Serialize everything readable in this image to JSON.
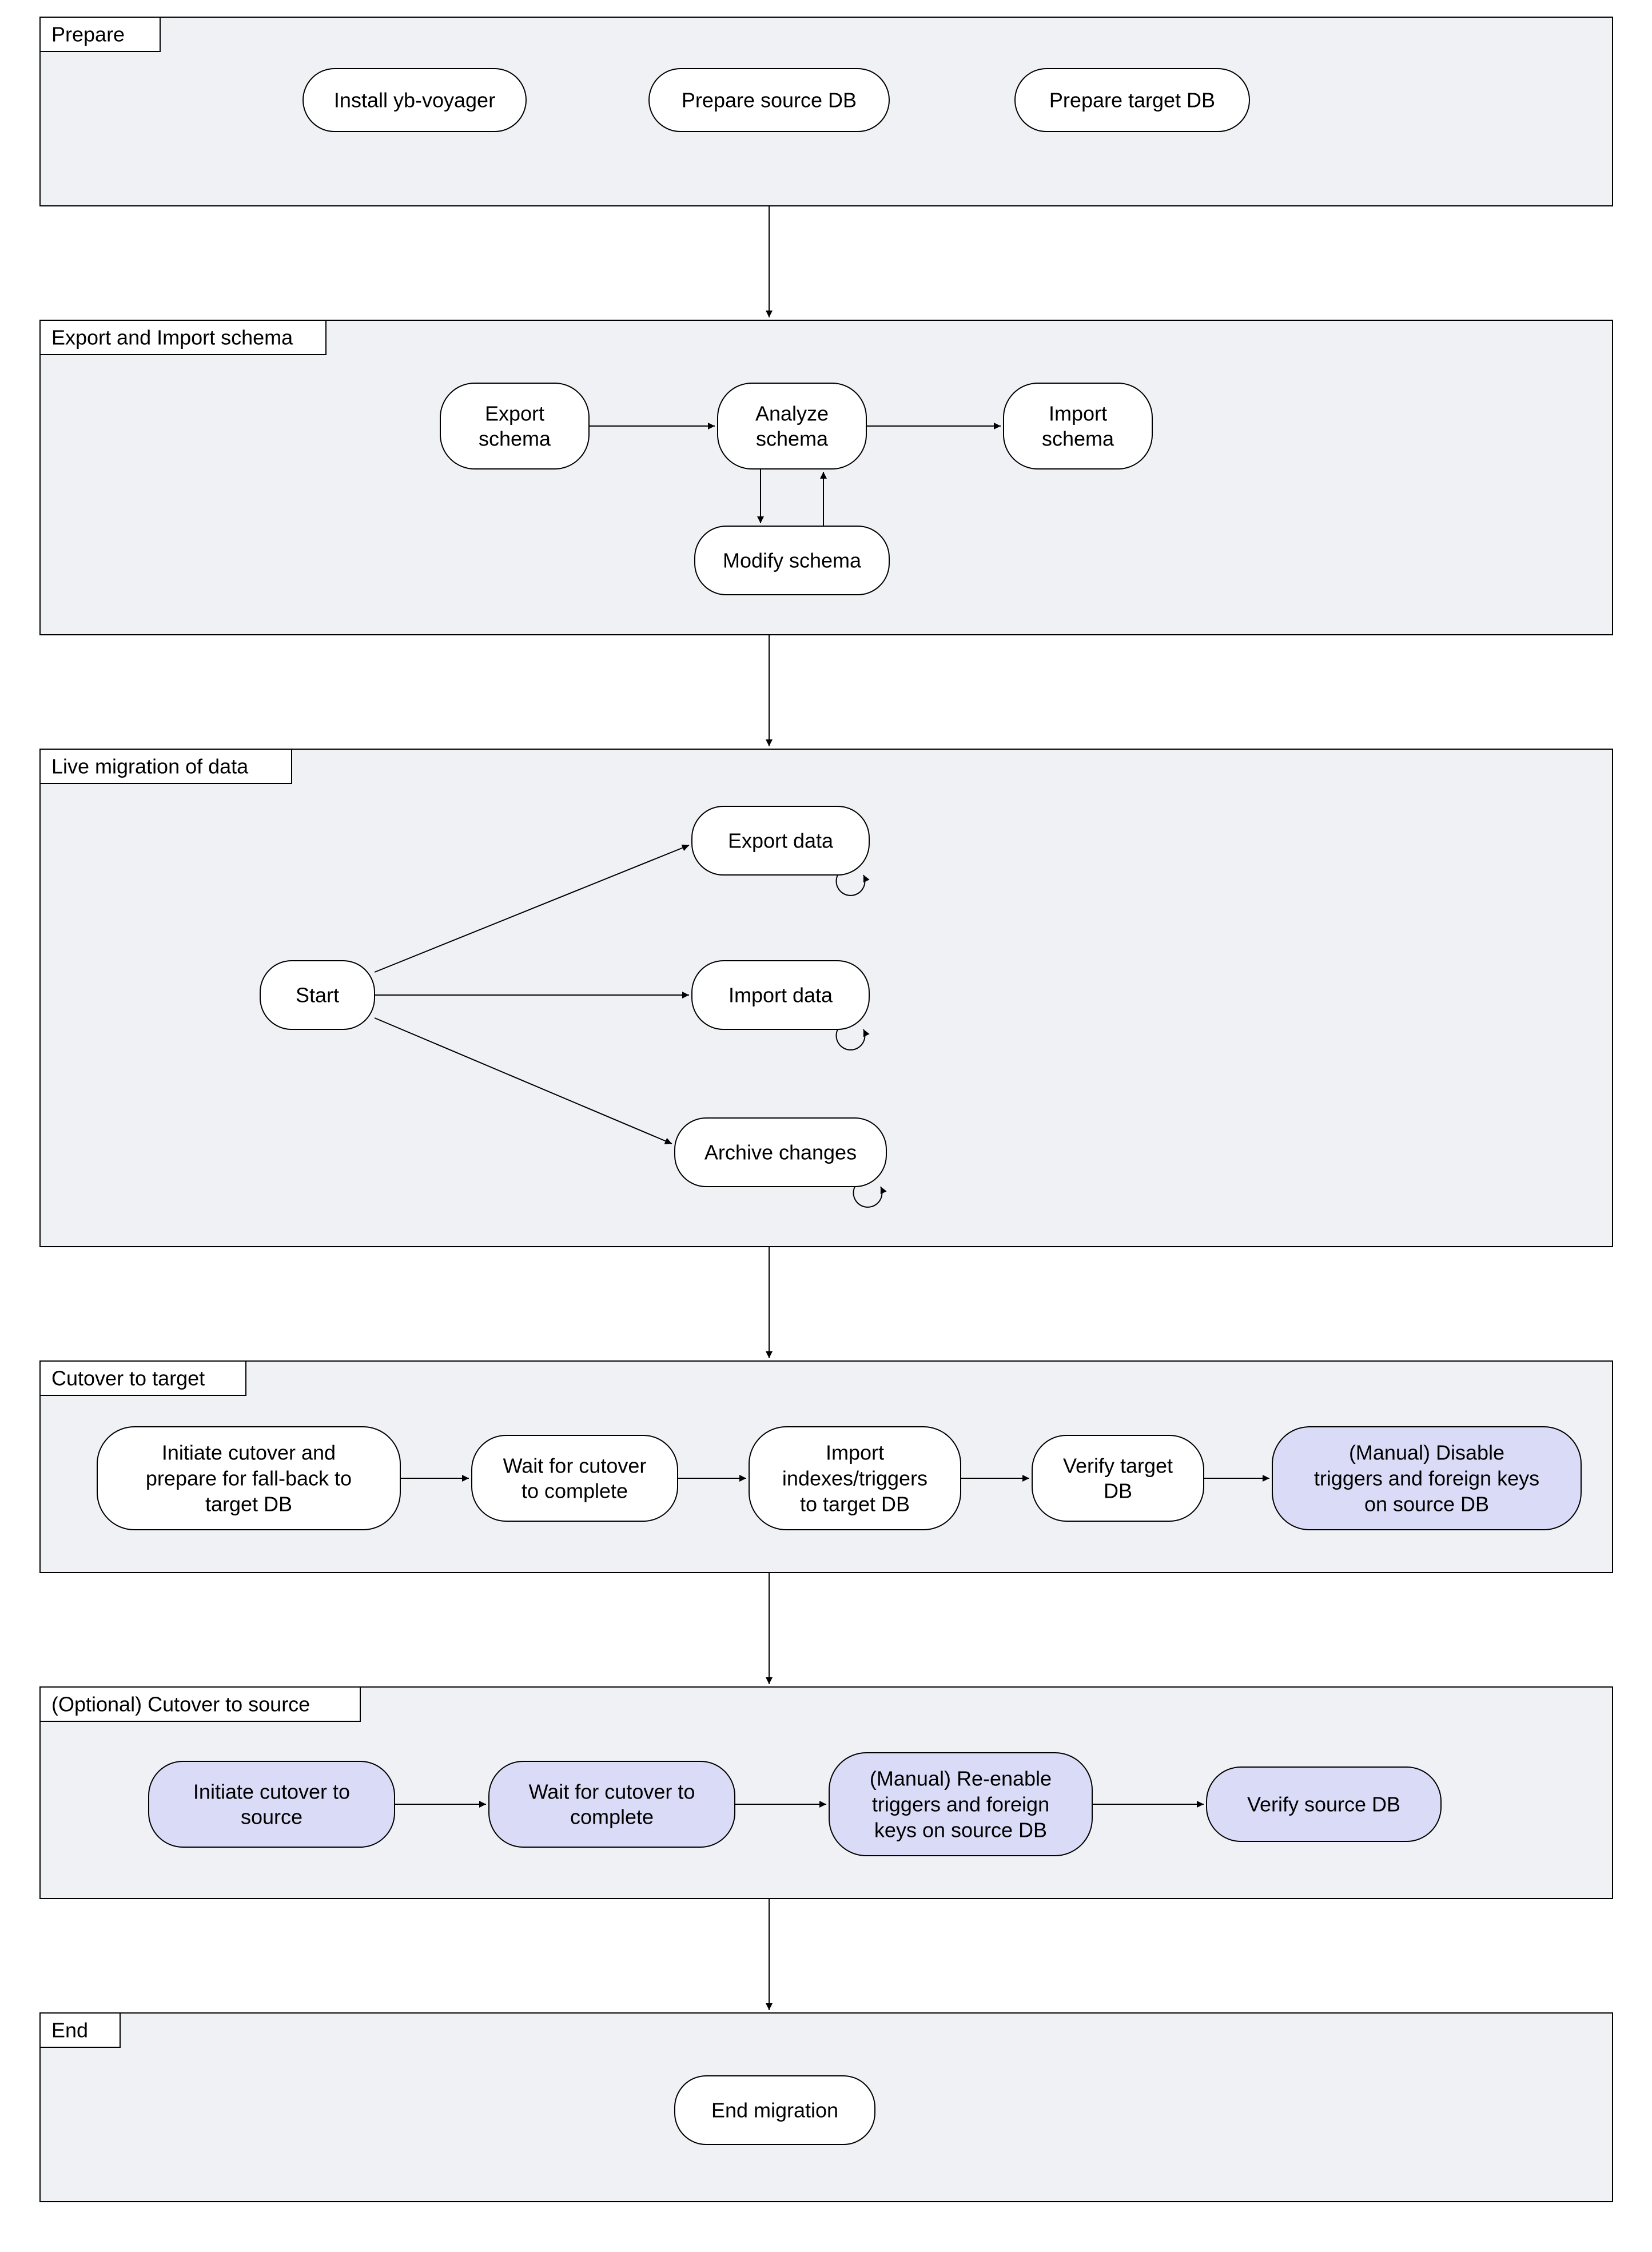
{
  "groups": {
    "g1": "Prepare",
    "g2": "Export and Import schema",
    "g3": "Live migration of data",
    "g4": "Cutover to target",
    "g5": "(Optional) Cutover to source",
    "g6": "End"
  },
  "nodes": {
    "prepare": {
      "install": "Install yb-voyager",
      "srcdb": "Prepare source DB",
      "tgtdb": "Prepare target DB"
    },
    "schema": {
      "export_l1": "Export",
      "export_l2": "schema",
      "analyze_l1": "Analyze",
      "analyze_l2": "schema",
      "import_l1": "Import",
      "import_l2": "schema",
      "modify": "Modify schema"
    },
    "live": {
      "start": "Start",
      "export": "Export data",
      "import": "Import data",
      "archive": "Archive changes"
    },
    "cutover_target": {
      "n1_l1": "Initiate cutover and",
      "n1_l2": "prepare for fall-back to",
      "n1_l3": "target DB",
      "n2_l1": "Wait for cutover",
      "n2_l2": "to complete",
      "n3_l1": "Import",
      "n3_l2": "indexes/triggers",
      "n3_l3": "to target DB",
      "n4_l1": "Verify target",
      "n4_l2": "DB",
      "n5_l1": "(Manual) Disable",
      "n5_l2": "triggers and foreign keys",
      "n5_l3": "on source DB"
    },
    "cutover_source": {
      "n1_l1": "Initiate cutover to",
      "n1_l2": "source",
      "n2_l1": "Wait for cutover to",
      "n2_l2": "complete",
      "n3_l1": "(Manual) Re-enable",
      "n3_l2": "triggers and foreign",
      "n3_l3": "keys on source DB",
      "n4": "Verify source DB"
    },
    "end": "End migration"
  }
}
